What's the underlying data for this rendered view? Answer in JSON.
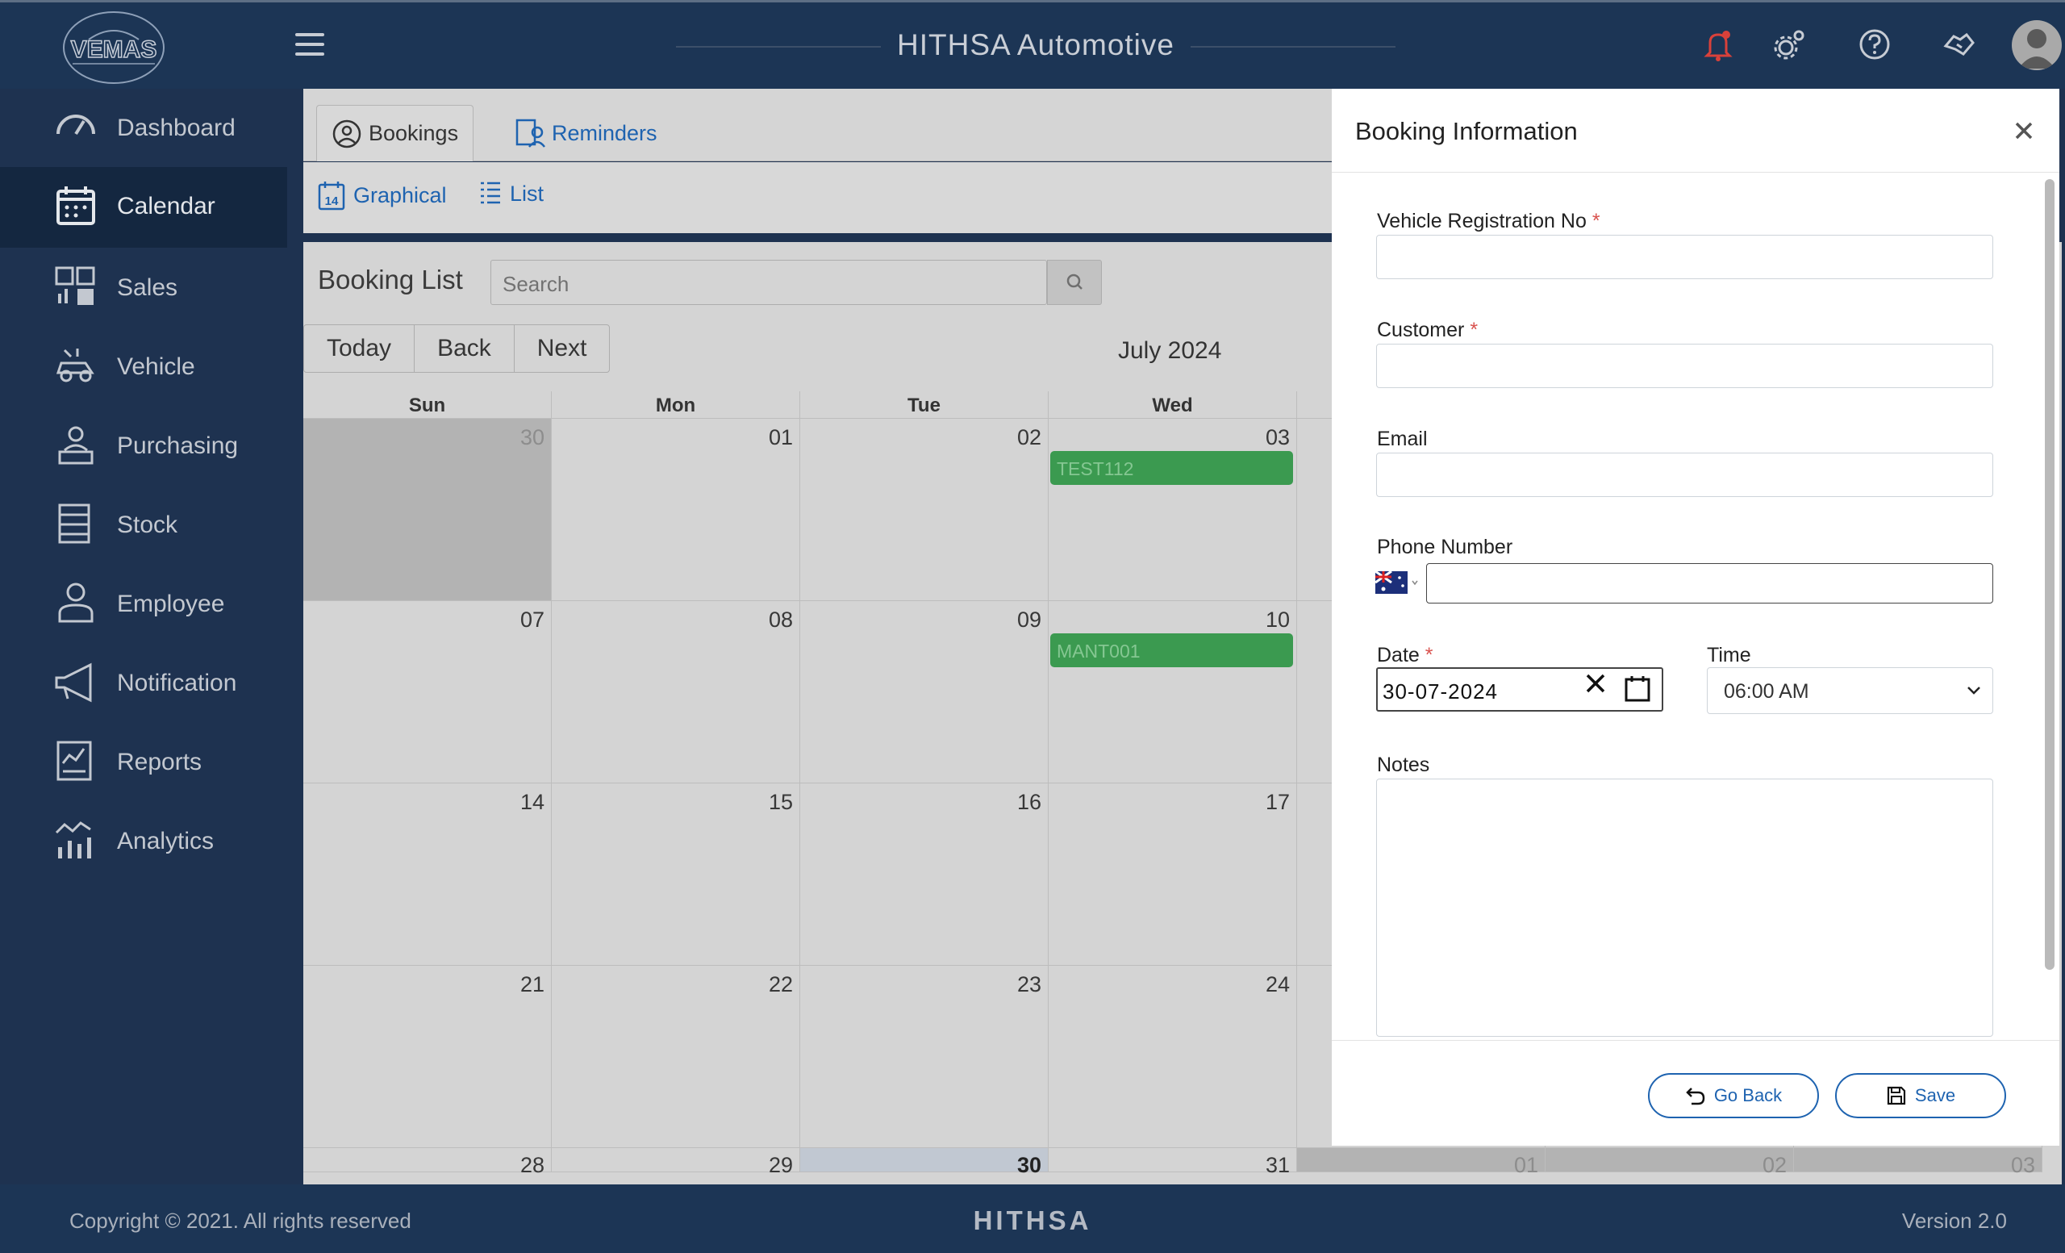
{
  "app": {
    "title": "HITHSA Automotive",
    "logo_text": "VEMAS"
  },
  "sidebar": {
    "items": [
      {
        "label": "Dashboard",
        "icon": "gauge-icon"
      },
      {
        "label": "Calendar",
        "icon": "calendar-icon",
        "active": true
      },
      {
        "label": "Sales",
        "icon": "sales-icon"
      },
      {
        "label": "Vehicle",
        "icon": "vehicle-icon"
      },
      {
        "label": "Purchasing",
        "icon": "purchasing-icon"
      },
      {
        "label": "Stock",
        "icon": "stock-icon"
      },
      {
        "label": "Employee",
        "icon": "employee-icon"
      },
      {
        "label": "Notification",
        "icon": "megaphone-icon"
      },
      {
        "label": "Reports",
        "icon": "reports-icon"
      },
      {
        "label": "Analytics",
        "icon": "analytics-icon"
      }
    ]
  },
  "tabs": {
    "bookings": "Bookings",
    "reminders": "Reminders"
  },
  "subtabs": {
    "graphical": "Graphical",
    "graphical_icon_text": "14",
    "list": "List"
  },
  "booking_list": {
    "title": "Booking List",
    "search_placeholder": "Search",
    "buttons": {
      "today": "Today",
      "back": "Back",
      "next": "Next"
    },
    "month": "July 2024",
    "days_of_week": [
      "Sun",
      "Mon",
      "Tue",
      "Wed"
    ],
    "weeks": [
      [
        "30",
        "01",
        "02",
        "03",
        "",
        "",
        ""
      ],
      [
        "07",
        "08",
        "09",
        "10",
        "",
        "",
        ""
      ],
      [
        "14",
        "15",
        "16",
        "17",
        "",
        "",
        ""
      ],
      [
        "21",
        "22",
        "23",
        "24",
        "",
        "",
        ""
      ],
      [
        "28",
        "29",
        "30",
        "31",
        "01",
        "02",
        "03"
      ]
    ],
    "events": [
      {
        "label": "TEST112",
        "date": "03"
      },
      {
        "label": "MANT001",
        "date": "10"
      }
    ]
  },
  "modal": {
    "title": "Booking Information",
    "fields": {
      "vehicle_reg_label": "Vehicle Registration No",
      "customer_label": "Customer",
      "email_label": "Email",
      "phone_label": "Phone Number",
      "date_label": "Date",
      "date_value": "30-07-2024",
      "time_label": "Time",
      "time_value": "06:00 AM",
      "notes_label": "Notes",
      "required_mark": "*"
    },
    "buttons": {
      "go_back": "Go Back",
      "save": "Save"
    }
  },
  "footer": {
    "copyright": "Copyright © 2021. All rights reserved",
    "brand": "HITHSA",
    "version": "Version 2.0"
  },
  "colors": {
    "topbar": "#1c3555",
    "sidebar": "#1e3250",
    "sidebar_active": "#142740",
    "event_green": "#3b9a50",
    "link_blue": "#1e63b0",
    "notification_red": "#d9413a"
  }
}
